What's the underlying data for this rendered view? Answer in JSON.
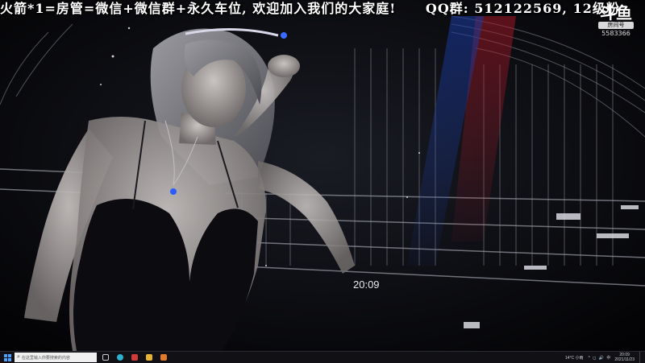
{
  "stream": {
    "banner_text": "火箭*1=房管=微信+微信群+永久车位, 欢迎加入我们的大家庭!",
    "qq_text": "QQ群: 512122569, 12级粉",
    "badge_logo": "斗鱼",
    "badge_tag": "房间号",
    "room_number": "5583366",
    "overlay_clock": "20:09"
  },
  "taskbar": {
    "search_placeholder": "在这里输入你要搜索的内容",
    "weather": "14°C 小雨",
    "system_icons": "^ ◻ 🔊 中",
    "time": "20:09",
    "date": "2021/11/23"
  },
  "colors": {
    "background": "#050507",
    "stage_red": "#b01828",
    "stage_blue": "#1a3aa0",
    "banner_text": "#ffffff"
  },
  "icons": [
    "windows-icon",
    "search-icon",
    "task-view-icon",
    "edge-icon",
    "app-icon-red",
    "app-icon-folder",
    "app-icon-orange"
  ]
}
